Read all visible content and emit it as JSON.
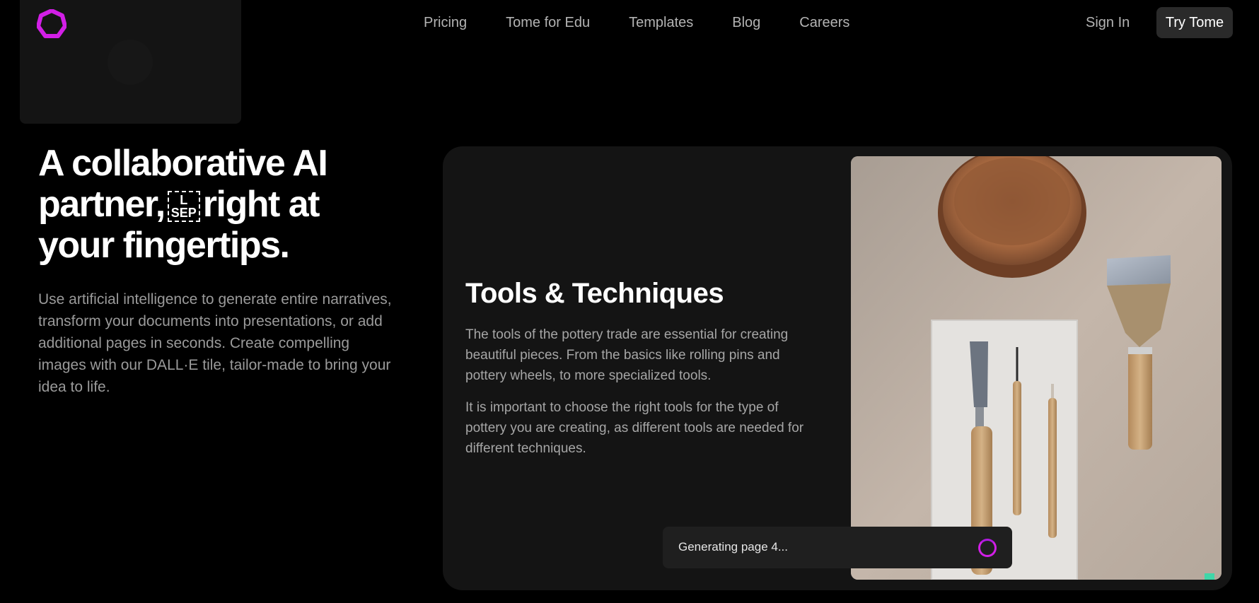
{
  "nav": {
    "links": [
      "Pricing",
      "Tome for Edu",
      "Templates",
      "Blog",
      "Careers"
    ],
    "signin_label": "Sign In",
    "cta_label": "Try Tome"
  },
  "hero": {
    "title_line1": "A collaborative AI",
    "title_line2_pre": "partner,",
    "sep_top": "L",
    "sep_bottom": "SEP",
    "title_line2_post": "right at",
    "title_line3": "your fingertips.",
    "description": "Use artificial intelligence to generate entire narratives, transform your documents into presentations, or add additional pages in seconds. Create compelling images with our DALL·E tile, tailor-made to bring your idea to life."
  },
  "card": {
    "heading": "Tools & Techniques",
    "paragraph1": "The tools of the pottery trade are essential for creating beautiful pieces. From the basics like rolling pins and pottery wheels, to more specialized tools.",
    "paragraph2": "It is important to choose the right tools for the type of pottery you are creating, as different tools are needed for different techniques."
  },
  "toast": {
    "text": "Generating page 4..."
  },
  "colors": {
    "background": "#000000",
    "card": "#141414",
    "accent_magenta": "#d21fe6",
    "button": "#2a2a2a"
  },
  "icons": {
    "logo": "tome-logo-icon",
    "spinner": "loading-spinner-icon"
  }
}
